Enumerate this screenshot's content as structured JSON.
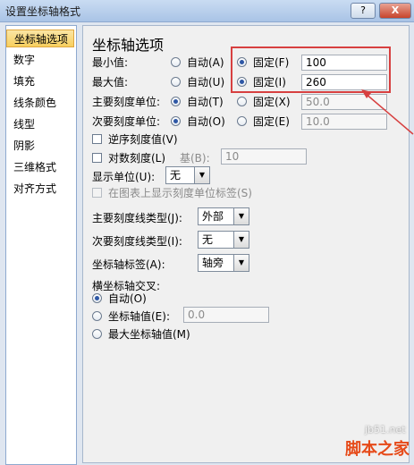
{
  "window": {
    "title": "设置坐标轴格式",
    "help_label": "?",
    "close_label": "X"
  },
  "sidebar": {
    "items": [
      {
        "label": "坐标轴选项"
      },
      {
        "label": "数字"
      },
      {
        "label": "填充"
      },
      {
        "label": "线条颜色"
      },
      {
        "label": "线型"
      },
      {
        "label": "阴影"
      },
      {
        "label": "三维格式"
      },
      {
        "label": "对齐方式"
      }
    ]
  },
  "main": {
    "heading": "坐标轴选项",
    "min": {
      "label": "最小值:",
      "auto": "自动(A)",
      "fixed": "固定(F)",
      "value": "100"
    },
    "max": {
      "label": "最大值:",
      "auto": "自动(U)",
      "fixed": "固定(I)",
      "value": "260"
    },
    "major": {
      "label": "主要刻度单位:",
      "auto": "自动(T)",
      "fixed": "固定(X)",
      "value": "50.0"
    },
    "minor": {
      "label": "次要刻度单位:",
      "auto": "自动(O)",
      "fixed": "固定(E)",
      "value": "10.0"
    },
    "reverse": {
      "label": "逆序刻度值(V)"
    },
    "log": {
      "label": "对数刻度(L)",
      "base_label": "基(B):",
      "base_value": "10"
    },
    "display_units": {
      "label": "显示单位(U):",
      "value": "无"
    },
    "show_units_label": {
      "label": "在图表上显示刻度单位标签(S)"
    },
    "major_tick": {
      "label": "主要刻度线类型(J):",
      "value": "外部"
    },
    "minor_tick": {
      "label": "次要刻度线类型(I):",
      "value": "无"
    },
    "axis_labels": {
      "label": "坐标轴标签(A):",
      "value": "轴旁"
    },
    "cross": {
      "label": "横坐标轴交叉:",
      "auto": "自动(O)",
      "value_option": "坐标轴值(E):",
      "value": "0.0",
      "max_option": "最大坐标轴值(M)"
    }
  },
  "watermark": {
    "site": "jb51.net",
    "brand": "脚本之家"
  }
}
